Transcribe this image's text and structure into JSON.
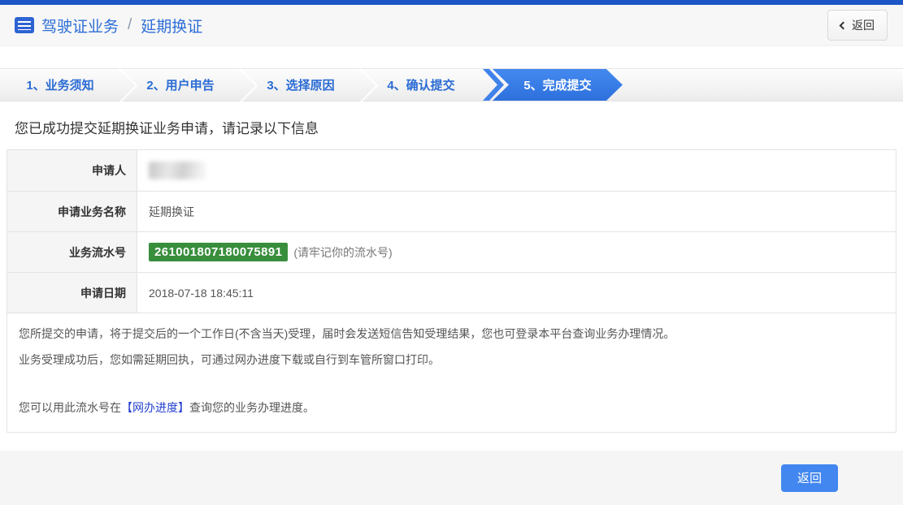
{
  "header": {
    "title_primary": "驾驶证业务",
    "title_separator": "/",
    "title_secondary": "延期换证",
    "back_label": "返回"
  },
  "icons": {
    "header_icon": "list-icon",
    "back_icon": "chevron-left-icon"
  },
  "steps": [
    {
      "label": "1、业务须知",
      "active": false
    },
    {
      "label": "2、用户申告",
      "active": false
    },
    {
      "label": "3、选择原因",
      "active": false
    },
    {
      "label": "4、确认提交",
      "active": false
    },
    {
      "label": "5、完成提交",
      "active": true
    }
  ],
  "main": {
    "success_message": "您已成功提交延期换证业务申请，请记录以下信息",
    "info_table": [
      {
        "label": "申请人",
        "value": "",
        "redacted": true
      },
      {
        "label": "申请业务名称",
        "value": "延期换证"
      },
      {
        "label": "业务流水号",
        "value": "261001807180075891",
        "value_note": "(请牢记你的流水号)",
        "highlight": true
      },
      {
        "label": "申请日期",
        "value": "2018-07-18 18:45:11"
      }
    ],
    "notes": {
      "line1": "您所提交的申请，将于提交后的一个工作日(不含当天)受理，届时会发送短信告知受理结果，您也可登录本平台查询业务办理情况。",
      "line2": "业务受理成功后，您如需延期回执，可通过网办进度下载或自行到车管所窗口打印。",
      "line3_prefix": "您可以用此流水号在",
      "line3_link": "【网办进度】",
      "line3_suffix": "查询您的业务办理进度。"
    },
    "footer": {
      "back_button_label": "返回"
    }
  },
  "colors": {
    "top_bar": "#1c56c6",
    "title_blue": "#2e6ed6",
    "active_tab_blue": "#3a7ee6",
    "serial_badge_green": "#388e3c",
    "link_blue": "#2540cf",
    "footer_button_blue": "#4287f0",
    "label_cell_gray": "#f5f5f5"
  }
}
